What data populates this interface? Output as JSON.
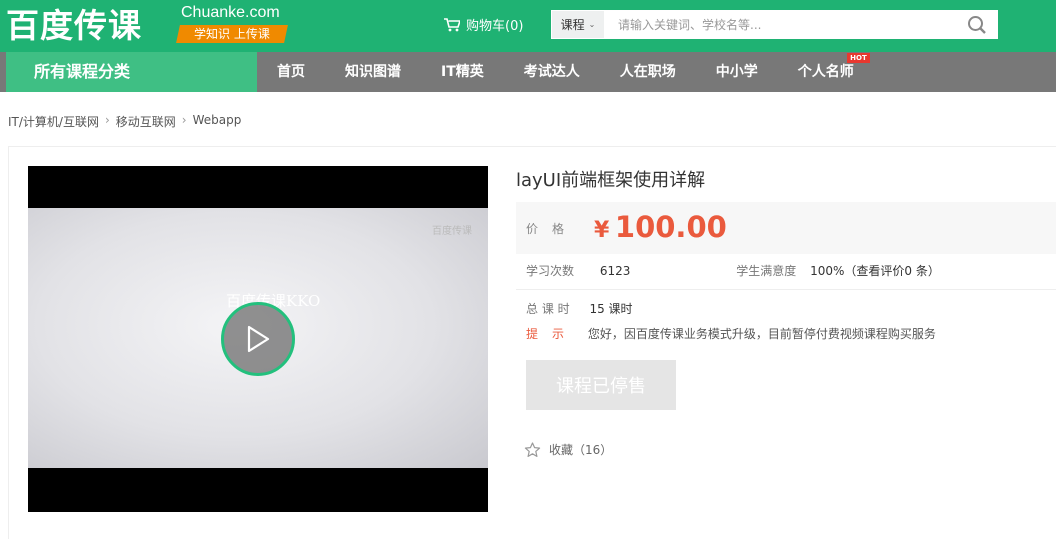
{
  "header": {
    "logo_cn": "百度传课",
    "logo_en": "Chuanke.com",
    "slogan": "学知识 上传课",
    "cart_label": "购物车(0)",
    "search": {
      "category": "课程",
      "placeholder": "请输入关键词、学校名等..."
    }
  },
  "nav": {
    "all_categories": "所有课程分类",
    "items": [
      {
        "label": "首页"
      },
      {
        "label": "知识图谱"
      },
      {
        "label": "IT精英"
      },
      {
        "label": "考试达人"
      },
      {
        "label": "人在职场"
      },
      {
        "label": "中小学"
      },
      {
        "label": "个人名师",
        "badge": "HOT"
      }
    ]
  },
  "breadcrumb": [
    "IT/计算机/互联网",
    "移动互联网",
    "Webapp"
  ],
  "video": {
    "watermark_corner": "百度传课",
    "watermark_center": "百度传课KKO"
  },
  "course": {
    "title": "layUI前端框架使用详解",
    "price_label": "价格",
    "currency": "¥",
    "price": "100.00",
    "study_count_label": "学习次数",
    "study_count": "6123",
    "satisfaction_label": "学生满意度",
    "satisfaction": "100%（查看评价0 条）",
    "hours_label": "总 课 时",
    "hours": "15 课时",
    "tip_label": "提示",
    "tip": "您好，因百度传课业务模式升级，目前暂停付费视频课程购买服务",
    "buy_button": "课程已停售",
    "favorite": "收藏（16）"
  },
  "colors": {
    "brand_green": "#1fb273",
    "nav_gray": "#787878",
    "price_red": "#ea5a3d",
    "slogan_orange": "#f08a00"
  }
}
